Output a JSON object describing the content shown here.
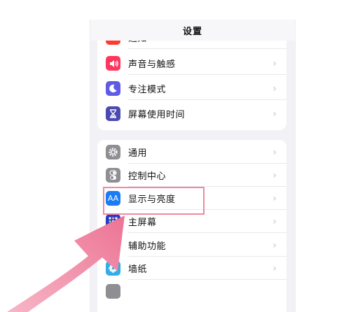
{
  "nav": {
    "title": "设置"
  },
  "groups": [
    {
      "items": [
        {
          "label": "通知",
          "icon": "notification-icon",
          "icon_color": "#ff3b30"
        },
        {
          "label": "声音与触感",
          "icon": "speaker-icon",
          "icon_color": "#ff375f"
        },
        {
          "label": "专注模式",
          "icon": "moon-icon",
          "icon_color": "#5e5ce6"
        },
        {
          "label": "屏幕使用时间",
          "icon": "hourglass-icon",
          "icon_color": "#4a4ab0"
        }
      ]
    },
    {
      "items": [
        {
          "label": "通用",
          "icon": "gear-icon",
          "icon_color": "#8e8e93"
        },
        {
          "label": "控制中心",
          "icon": "toggle-icon",
          "icon_color": "#8e8e93"
        },
        {
          "label": "显示与亮度",
          "icon": "text-size-icon",
          "icon_color": "#1a7cf5",
          "icon_text": "AA",
          "highlighted": true
        },
        {
          "label": "主屏幕",
          "icon": "home-grid-icon",
          "icon_color": "#2b3ac4"
        },
        {
          "label": "辅助功能",
          "icon": "accessibility-icon",
          "icon_color": "#1a7cf5"
        },
        {
          "label": "墙纸",
          "icon": "flower-icon",
          "icon_color": "#32ade6"
        }
      ]
    }
  ],
  "annotation": {
    "highlight_color": "#f08aa0",
    "arrow_color": "#ef7e9a"
  }
}
